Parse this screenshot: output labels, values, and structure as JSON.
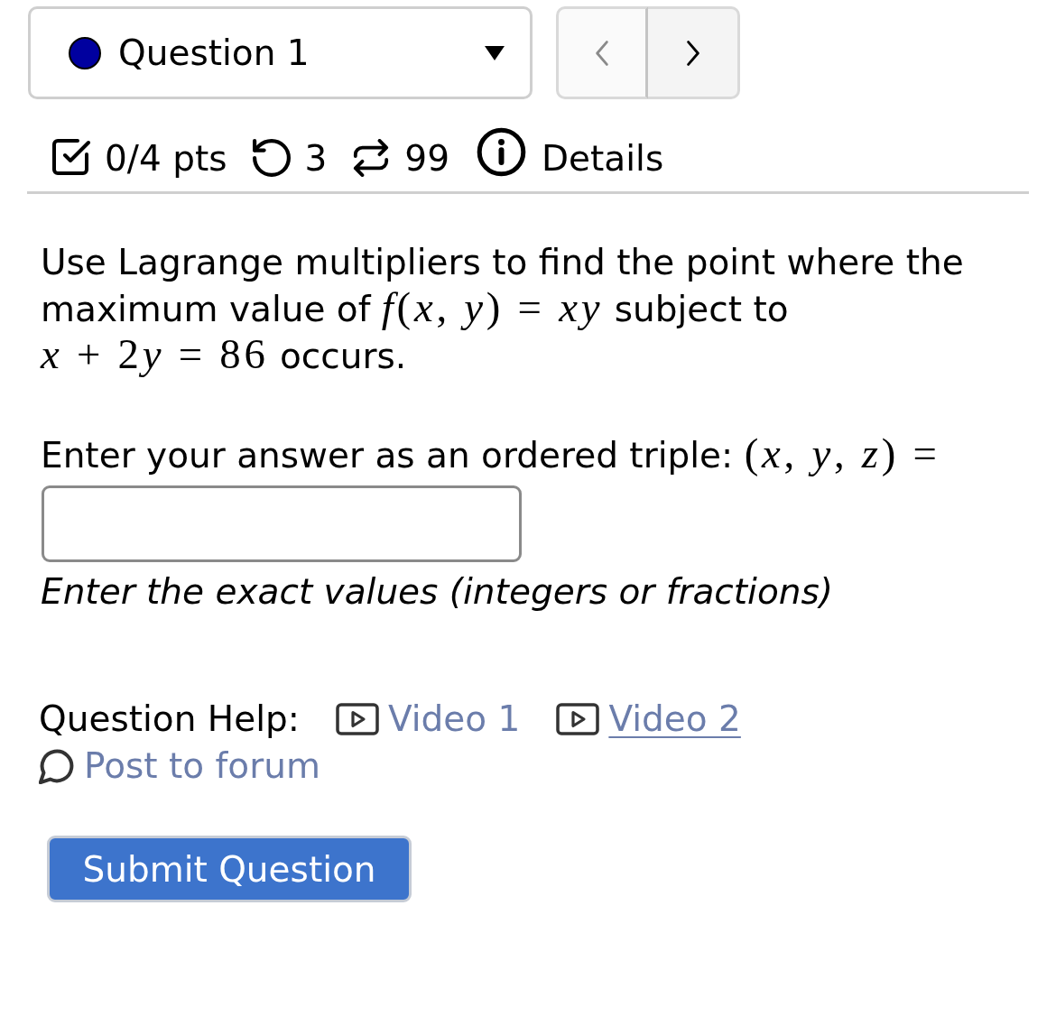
{
  "question_selector": {
    "label": "Question 1",
    "color": "#00009f"
  },
  "navigation": [
    {
      "kind": "previous",
      "disabled": true
    },
    {
      "kind": "next",
      "disabled": false
    }
  ],
  "meta": [
    {
      "kind": "score",
      "text": "0/4 pts"
    },
    {
      "kind": "attempts",
      "text": "3"
    },
    {
      "kind": "submissions",
      "text": "99"
    },
    {
      "kind": "details",
      "text": "Details"
    }
  ],
  "question": {
    "segments": [
      {
        "kind": "text",
        "text": "Use Lagrange multipliers to find the point where the maximum value of "
      },
      {
        "kind": "math",
        "text": "f(x, y) = xy"
      },
      {
        "kind": "text",
        "text": " subject to "
      },
      {
        "kind": "math",
        "text": "x + 2y = 86"
      },
      {
        "kind": "text",
        "text": " occurs."
      }
    ]
  },
  "answer": {
    "prompt": [
      {
        "kind": "text",
        "text": "Enter your answer as an ordered triple: "
      },
      {
        "kind": "math",
        "text": "(x, y, z) ="
      }
    ],
    "hint": "Enter the exact values (integers or fractions)"
  },
  "help": {
    "label": "Question Help:",
    "links": [
      {
        "kind": "video",
        "label": "Video 1",
        "hovered": false
      },
      {
        "kind": "video",
        "label": "Video 2",
        "hovered": true
      },
      {
        "kind": "forum",
        "label": "Post to forum",
        "hovered": false
      }
    ]
  },
  "submit": {
    "label": "Submit Question"
  }
}
